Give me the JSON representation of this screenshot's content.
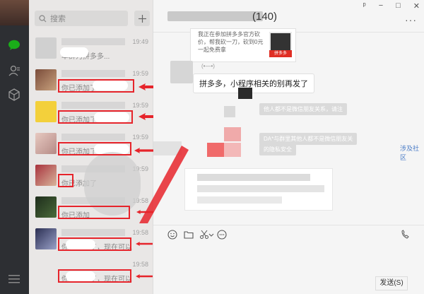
{
  "chat": {
    "member_count": "(140)",
    "card_text": "我正在参加拼多多官方砍价，帮我砍一刀，砍到0元一起免费拿",
    "card_badge": "拼多多",
    "message_sender": "(•—•)",
    "message_text": "拼多多，小程序相关的别再发了",
    "system_notices": [
      "他人都不是微信朋友关系，请注",
      "DA*与群里其他人都不是微信朋友关",
      "的隐私安全"
    ],
    "link_text": "涉及社区",
    "send_label": "发送(S)"
  },
  "window": {
    "pin": "ᵖ",
    "minimize": "−",
    "maximize": "□",
    "close": "✕",
    "more": "···"
  },
  "search": {
    "placeholder": "搜索"
  },
  "conversations": [
    {
      "time": "19:49",
      "preview": "本群为拼多多..."
    },
    {
      "time": "19:59",
      "preview": "你已添加了"
    },
    {
      "time": "19:59",
      "preview": "你已添加了"
    },
    {
      "time": "19:59",
      "preview": "你已添加了"
    },
    {
      "time": "19:59",
      "preview": "你已添加了"
    },
    {
      "time": "19:58",
      "preview": "你已添加"
    },
    {
      "time": "19:58",
      "preview": "你已添加了，现在可以"
    },
    {
      "time": "19:58",
      "preview": "你已添加了，现在可以"
    }
  ],
  "colors": {
    "rail": "#2d2f33",
    "accent_green": "#1aad19",
    "annotation_red": "#e6242b",
    "list_bg": "#e9e7e6"
  }
}
